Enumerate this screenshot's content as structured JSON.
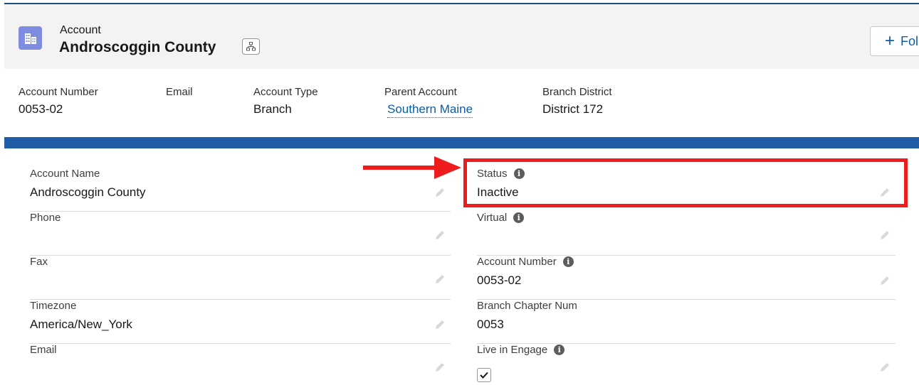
{
  "header": {
    "object_label": "Account",
    "record_title": "Androscoggin County",
    "follow_label": "Fol",
    "icon": "account-building-icon"
  },
  "highlights": [
    {
      "label": "Account Number",
      "value": "0053-02"
    },
    {
      "label": "Email",
      "value": ""
    },
    {
      "label": "Account Type",
      "value": "Branch"
    },
    {
      "label": "Parent Account",
      "value": "Southern Maine"
    },
    {
      "label": "Branch District",
      "value": "District 172"
    }
  ],
  "left_fields": [
    {
      "label": "Account Name",
      "value": "Androscoggin County"
    },
    {
      "label": "Phone",
      "value": ""
    },
    {
      "label": "Fax",
      "value": ""
    },
    {
      "label": "Timezone",
      "value": "America/New_York"
    },
    {
      "label": "Email",
      "value": ""
    }
  ],
  "right_fields": [
    {
      "label": "Status",
      "value": "Inactive"
    },
    {
      "label": "Virtual",
      "value": ""
    },
    {
      "label": "Account Number",
      "value": "0053-02"
    },
    {
      "label": "Branch Chapter Num",
      "value": "0053"
    },
    {
      "label": "Live in Engage",
      "value": "",
      "checked": true
    }
  ],
  "colors": {
    "brand_blue": "#1f5ea7",
    "link": "#0b5cab",
    "annotation_red": "#ee1c1c",
    "account_icon": "#7f8de1"
  }
}
